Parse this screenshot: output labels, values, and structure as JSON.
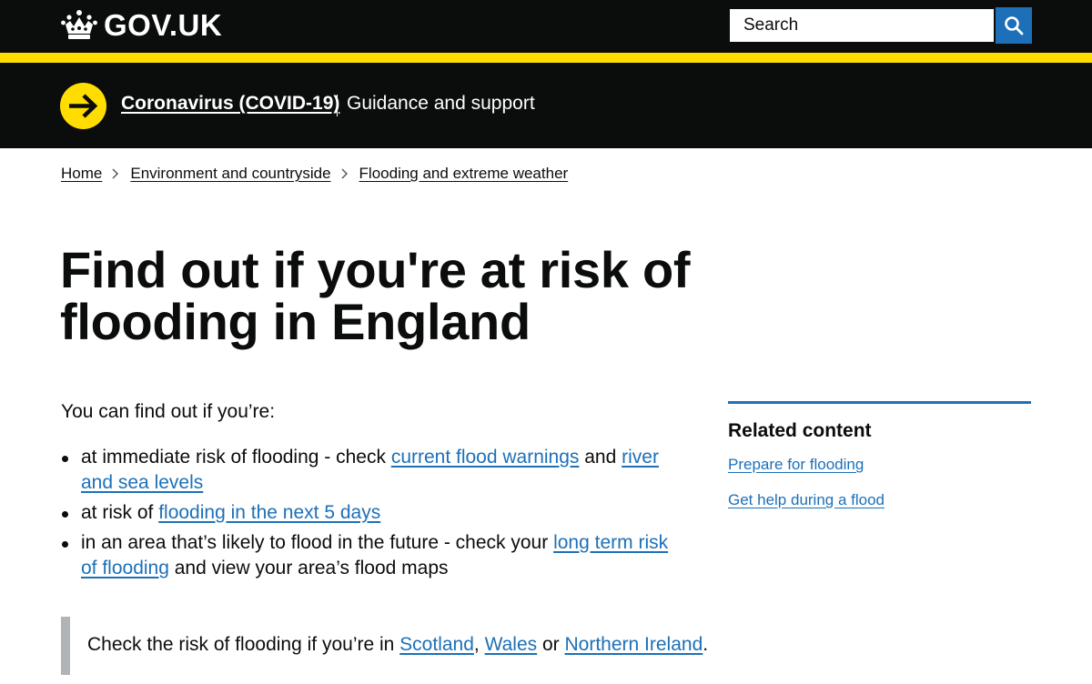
{
  "header": {
    "logo_text": "GOV.UK",
    "search_placeholder": "Search",
    "colors": {
      "background": "#0b0c0c",
      "accent_bar": "#ffdd00",
      "search_button": "#1d70b8"
    }
  },
  "covid_banner": {
    "link_label": "Coronavirus (COVID-19)",
    "subtitle": "Guidance and support",
    "arrow_color": "#ffdd00"
  },
  "breadcrumbs": [
    {
      "label": "Home"
    },
    {
      "label": "Environment and countryside"
    },
    {
      "label": "Flooding and extreme weather"
    }
  ],
  "page_title": "Find out if you're at risk of flooding in England",
  "intro": "You can find out if you’re:",
  "bullets": {
    "b1": {
      "t1": "at immediate risk of flooding - check ",
      "l1": "current flood warnings",
      "t2": " and ",
      "l2": "river and sea levels"
    },
    "b2": {
      "t1": "at risk of ",
      "l1": "flooding in the next 5 days"
    },
    "b3": {
      "t1": "in an area that’s likely to flood in the future - check your ",
      "l1": "long term risk of flooding",
      "t2": " and view your area’s flood maps"
    }
  },
  "inset": {
    "t1": "Check the risk of flooding if you’re in ",
    "l1": "Scotland",
    "t2": ", ",
    "l2": "Wales",
    "t3": " or ",
    "l3": "Northern Ireland",
    "t4": "."
  },
  "related": {
    "title": "Related content",
    "links": [
      {
        "label": "Prepare for flooding"
      },
      {
        "label": "Get help during a flood"
      }
    ]
  },
  "colors": {
    "link": "#1d70b8",
    "text": "#0b0c0c",
    "inset_border": "#b1b4b6"
  }
}
